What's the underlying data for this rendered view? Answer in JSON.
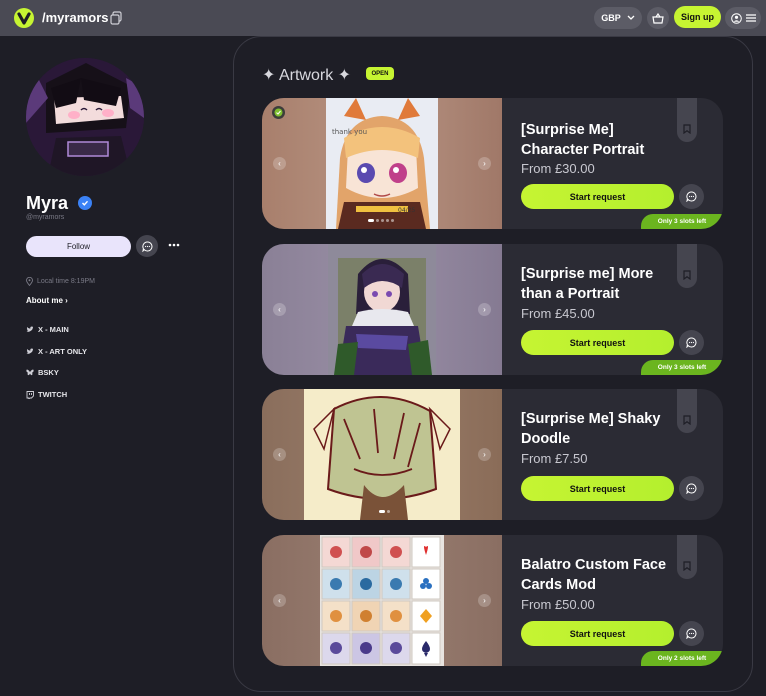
{
  "topbar": {
    "handle": "/myramors",
    "currency": "GBP",
    "signup_label": "Sign up"
  },
  "profile": {
    "name": "Myra",
    "handle": "@myramors",
    "follow_label": "Follow",
    "local_time": "Local time 8:19PM",
    "about_label": "About me",
    "links": [
      {
        "label": "X - MAIN",
        "icon": "x-bird-icon"
      },
      {
        "label": "X - ART ONLY",
        "icon": "x-bird-icon"
      },
      {
        "label": "BSKY",
        "icon": "butterfly-icon"
      },
      {
        "label": "TWITCH",
        "icon": "twitch-icon"
      }
    ]
  },
  "section": {
    "title": "✦ Artwork ✦",
    "status_badge": "OPEN"
  },
  "listings": [
    {
      "title": "[Surprise Me] Character Portrait",
      "price": "From £30.00",
      "cta": "Start request",
      "slots": "Only 3 slots left"
    },
    {
      "title": "[Surprise me] More than a Portrait",
      "price": "From £45.00",
      "cta": "Start request",
      "slots": "Only 3 slots left"
    },
    {
      "title": "[Surprise Me] Shaky Doodle",
      "price": "From £7.50",
      "cta": "Start request",
      "slots": ""
    },
    {
      "title": "Balatro Custom Face Cards Mod",
      "price": "From £50.00",
      "cta": "Start request",
      "slots": "Only 2 slots left"
    }
  ],
  "colors": {
    "accent": "#c6f432",
    "background": "#1e1e26",
    "card": "#2b2b34",
    "topbar": "#4a4a54",
    "slots_badge": "#6bb51f"
  }
}
